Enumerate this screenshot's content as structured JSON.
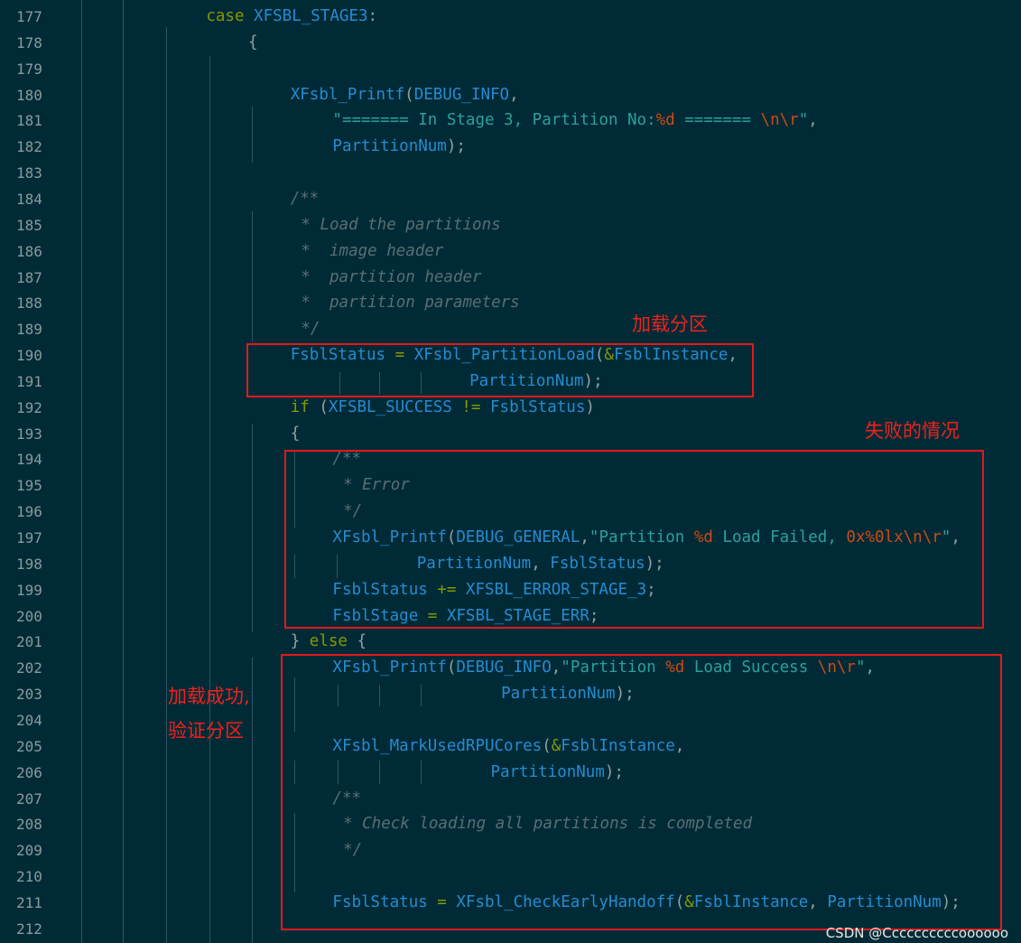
{
  "lines": [
    {
      "n": "177",
      "indent": 11,
      "tokens": [
        [
          "case ",
          "t-k"
        ],
        [
          "XFSBL_STAGE3",
          "t-f"
        ],
        [
          ":",
          "t-p"
        ]
      ]
    },
    {
      "n": "178",
      "indent": 15,
      "tokens": [
        [
          "{",
          "t-p"
        ]
      ]
    },
    {
      "n": "179",
      "indent": 0,
      "tokens": []
    },
    {
      "n": "180",
      "indent": 19,
      "tokens": [
        [
          "XFsbl_Printf",
          "t-f"
        ],
        [
          "(",
          "t-p"
        ],
        [
          "DEBUG_INFO",
          "t-f"
        ],
        [
          ",",
          "t-p"
        ]
      ]
    },
    {
      "n": "181",
      "indent": 23,
      "tokens": [
        [
          "\"======= In Stage 3, Partition No:",
          "t-s"
        ],
        [
          "%d",
          "t-e"
        ],
        [
          " ======= ",
          "t-s"
        ],
        [
          "\\n\\r",
          "t-e"
        ],
        [
          "\"",
          "t-s"
        ],
        [
          ",",
          "t-p"
        ]
      ]
    },
    {
      "n": "182",
      "indent": 23,
      "tokens": [
        [
          "PartitionNum",
          "t-f"
        ],
        [
          ");",
          "t-p"
        ]
      ]
    },
    {
      "n": "183",
      "indent": 0,
      "tokens": []
    },
    {
      "n": "184",
      "indent": 19,
      "tokens": [
        [
          "/**",
          "t-c"
        ]
      ]
    },
    {
      "n": "185",
      "indent": 20,
      "tokens": [
        [
          "* Load the partitions",
          "t-c"
        ]
      ]
    },
    {
      "n": "186",
      "indent": 20,
      "tokens": [
        [
          "*  image header",
          "t-c"
        ]
      ]
    },
    {
      "n": "187",
      "indent": 20,
      "tokens": [
        [
          "*  partition header",
          "t-c"
        ]
      ]
    },
    {
      "n": "188",
      "indent": 20,
      "tokens": [
        [
          "*  partition parameters",
          "t-c"
        ]
      ]
    },
    {
      "n": "189",
      "indent": 20,
      "tokens": [
        [
          "*/",
          "t-c"
        ]
      ]
    },
    {
      "n": "190",
      "indent": 19,
      "tokens": [
        [
          "FsblStatus",
          "t-f"
        ],
        [
          " = ",
          "t-o"
        ],
        [
          "XFsbl_PartitionLoad",
          "t-f"
        ],
        [
          "(",
          "t-p"
        ],
        [
          "&",
          "t-o"
        ],
        [
          "FsblInstance",
          "t-f"
        ],
        [
          ",",
          "t-p"
        ]
      ]
    },
    {
      "n": "191",
      "indent": 36,
      "tokens": [
        [
          "PartitionNum",
          "t-f"
        ],
        [
          ");",
          "t-p"
        ]
      ]
    },
    {
      "n": "192",
      "indent": 19,
      "tokens": [
        [
          "if ",
          "t-k"
        ],
        [
          "(",
          "t-p"
        ],
        [
          "XFSBL_SUCCESS",
          "t-f"
        ],
        [
          " != ",
          "t-o"
        ],
        [
          "FsblStatus",
          "t-f"
        ],
        [
          ")",
          "t-p"
        ]
      ]
    },
    {
      "n": "193",
      "indent": 19,
      "tokens": [
        [
          "{",
          "t-p"
        ]
      ]
    },
    {
      "n": "194",
      "indent": 23,
      "tokens": [
        [
          "/**",
          "t-c"
        ]
      ]
    },
    {
      "n": "195",
      "indent": 24,
      "tokens": [
        [
          "* Error",
          "t-c"
        ]
      ]
    },
    {
      "n": "196",
      "indent": 24,
      "tokens": [
        [
          "*/",
          "t-c"
        ]
      ]
    },
    {
      "n": "197",
      "indent": 23,
      "tokens": [
        [
          "XFsbl_Printf",
          "t-f"
        ],
        [
          "(",
          "t-p"
        ],
        [
          "DEBUG_GENERAL",
          "t-f"
        ],
        [
          ",",
          "t-p"
        ],
        [
          "\"Partition ",
          "t-s"
        ],
        [
          "%d",
          "t-e"
        ],
        [
          " Load Failed, ",
          "t-s"
        ],
        [
          "0x%0lx\\n\\r",
          "t-e"
        ],
        [
          "\"",
          "t-s"
        ],
        [
          ",",
          "t-p"
        ]
      ]
    },
    {
      "n": "198",
      "indent": 31,
      "tokens": [
        [
          "PartitionNum",
          "t-f"
        ],
        [
          ", ",
          "t-p"
        ],
        [
          "FsblStatus",
          "t-f"
        ],
        [
          ");",
          "t-p"
        ]
      ]
    },
    {
      "n": "199",
      "indent": 23,
      "tokens": [
        [
          "FsblStatus",
          "t-f"
        ],
        [
          " += ",
          "t-o"
        ],
        [
          "XFSBL_ERROR_STAGE_3",
          "t-f"
        ],
        [
          ";",
          "t-p"
        ]
      ]
    },
    {
      "n": "200",
      "indent": 23,
      "tokens": [
        [
          "FsblStage",
          "t-f"
        ],
        [
          " = ",
          "t-o"
        ],
        [
          "XFSBL_STAGE_ERR",
          "t-f"
        ],
        [
          ";",
          "t-p"
        ]
      ]
    },
    {
      "n": "201",
      "indent": 19,
      "tokens": [
        [
          "} ",
          "t-p"
        ],
        [
          "else",
          "t-k"
        ],
        [
          " {",
          "t-p"
        ]
      ]
    },
    {
      "n": "202",
      "indent": 23,
      "tokens": [
        [
          "XFsbl_Printf",
          "t-f"
        ],
        [
          "(",
          "t-p"
        ],
        [
          "DEBUG_INFO",
          "t-f"
        ],
        [
          ",",
          "t-p"
        ],
        [
          "\"Partition ",
          "t-s"
        ],
        [
          "%d",
          "t-e"
        ],
        [
          " Load Success ",
          "t-s"
        ],
        [
          "\\n\\r",
          "t-e"
        ],
        [
          "\"",
          "t-s"
        ],
        [
          ",",
          "t-p"
        ]
      ]
    },
    {
      "n": "203",
      "indent": 39,
      "tokens": [
        [
          "PartitionNum",
          "t-f"
        ],
        [
          ");",
          "t-p"
        ]
      ]
    },
    {
      "n": "204",
      "indent": 0,
      "tokens": []
    },
    {
      "n": "205",
      "indent": 23,
      "tokens": [
        [
          "XFsbl_MarkUsedRPUCores",
          "t-f"
        ],
        [
          "(",
          "t-p"
        ],
        [
          "&",
          "t-o"
        ],
        [
          "FsblInstance",
          "t-f"
        ],
        [
          ",",
          "t-p"
        ]
      ]
    },
    {
      "n": "206",
      "indent": 38,
      "tokens": [
        [
          "PartitionNum",
          "t-f"
        ],
        [
          ");",
          "t-p"
        ]
      ]
    },
    {
      "n": "207",
      "indent": 23,
      "tokens": [
        [
          "/**",
          "t-c"
        ]
      ]
    },
    {
      "n": "208",
      "indent": 24,
      "tokens": [
        [
          "* Check loading all partitions is completed",
          "t-c"
        ]
      ]
    },
    {
      "n": "209",
      "indent": 24,
      "tokens": [
        [
          "*/",
          "t-c"
        ]
      ]
    },
    {
      "n": "210",
      "indent": 0,
      "tokens": []
    },
    {
      "n": "211",
      "indent": 23,
      "tokens": [
        [
          "FsblStatus",
          "t-f"
        ],
        [
          " = ",
          "t-o"
        ],
        [
          "XFsbl_CheckEarlyHandoff",
          "t-f"
        ],
        [
          "(",
          "t-p"
        ],
        [
          "&",
          "t-o"
        ],
        [
          "FsblInstance",
          "t-f"
        ],
        [
          ", ",
          "t-p"
        ],
        [
          "PartitionNum",
          "t-f"
        ],
        [
          ");",
          "t-p"
        ]
      ]
    },
    {
      "n": "212",
      "indent": 0,
      "tokens": []
    }
  ],
  "annotations": {
    "load_partition": "加载分区",
    "failure_case": "失败的情况",
    "success_line1": "加载成功,",
    "success_line2": "验证分区"
  },
  "watermark": "CSDN @Ccccccccccoooooo",
  "colors": {
    "background": "#002B36",
    "line_number": "#8A9A9E",
    "keyword": "#859900",
    "identifier": "#268BD2",
    "string": "#2AA198",
    "escape": "#CB4B16",
    "comment": "#586E75",
    "annotation_red": "#E0191B"
  }
}
